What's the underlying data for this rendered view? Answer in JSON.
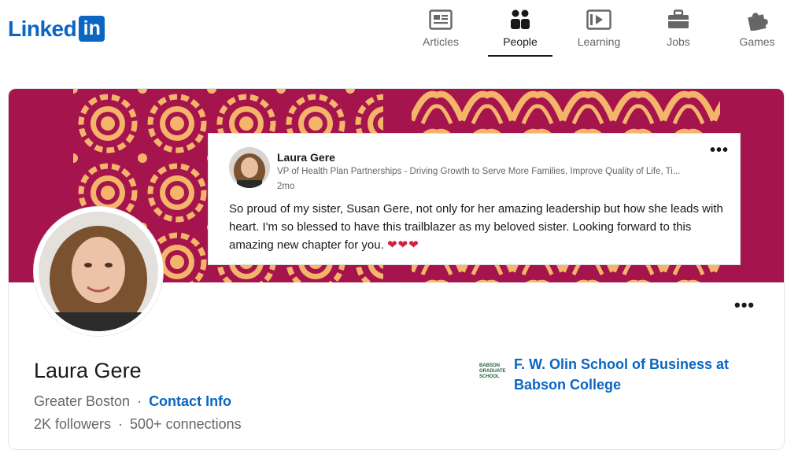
{
  "header": {
    "logo_text": "Linked",
    "logo_box": "in",
    "nav": [
      {
        "label": "Articles",
        "icon": "articles-icon"
      },
      {
        "label": "People",
        "icon": "people-icon",
        "active": true
      },
      {
        "label": "Learning",
        "icon": "learning-icon"
      },
      {
        "label": "Jobs",
        "icon": "briefcase-icon"
      },
      {
        "label": "Games",
        "icon": "puzzle-icon"
      }
    ]
  },
  "post": {
    "author": "Laura Gere",
    "headline": "VP of Health Plan Partnerships - Driving Growth to Serve More Families, Improve Quality of Life, Ti...",
    "time": "2mo",
    "more": "•••",
    "body": "So proud of my sister, Susan Gere, not only for her amazing leadership but how she leads with heart. I'm so blessed to have this trailblazer as my beloved sister. Looking forward to this amazing new chapter for you.",
    "hearts": "❤❤❤"
  },
  "profile": {
    "name": "Laura Gere",
    "location": "Greater Boston",
    "separator": "·",
    "contact_info": "Contact Info",
    "followers": "2K followers",
    "connections": "500+ connections",
    "more": "•••"
  },
  "education": {
    "school": "F. W. Olin School of Business at Babson College",
    "logo_text": "BABSON GRADUATE SCHOOL"
  },
  "colors": {
    "brand": "#0a66c2",
    "banner": "#a6144e",
    "pattern": "#f4b56a"
  }
}
